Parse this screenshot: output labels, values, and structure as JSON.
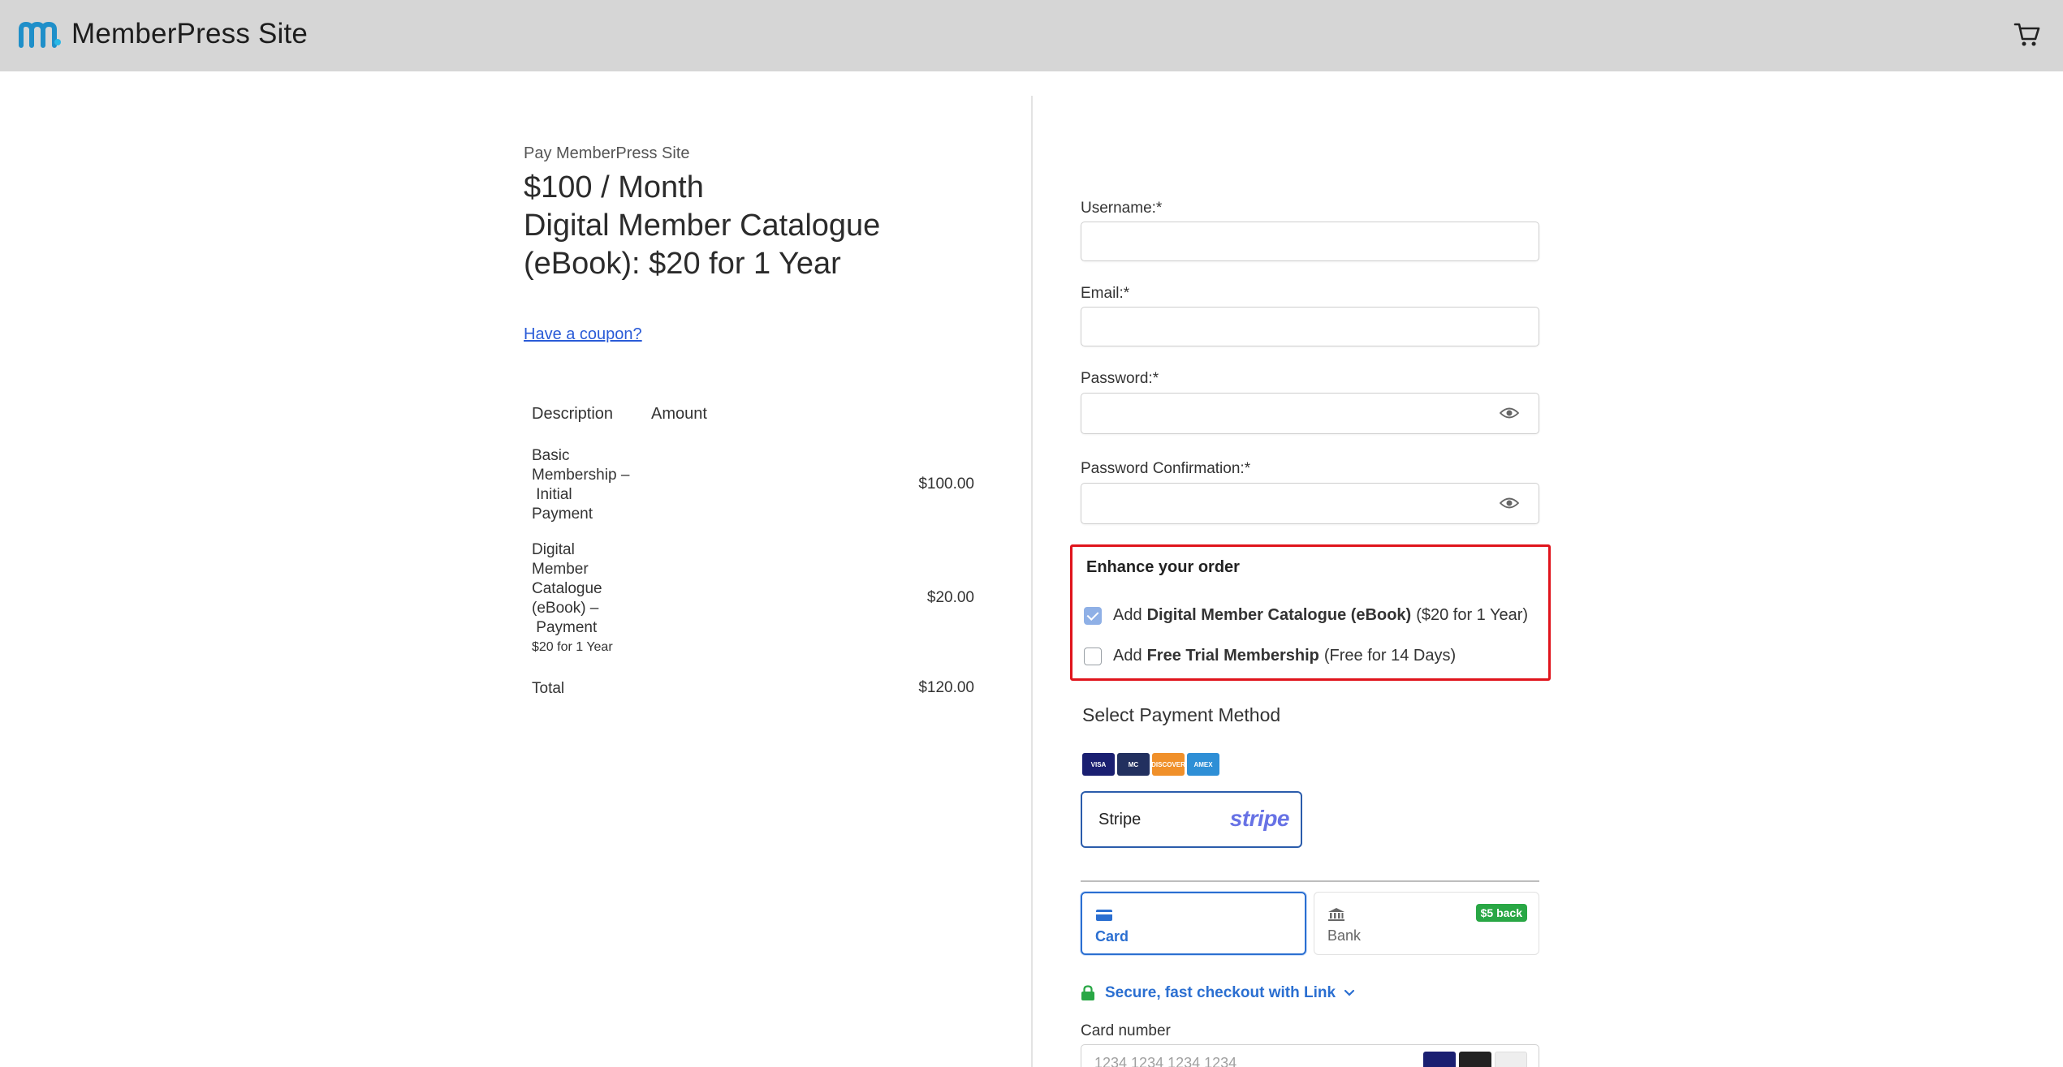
{
  "header": {
    "site_title": "MemberPress Site",
    "logo_icon": "memberpress-m-icon",
    "cart_icon": "cart-icon"
  },
  "summary": {
    "pay_label": "Pay MemberPress Site",
    "price": "$100 / Month",
    "product": "Digital Member Catalogue (eBook): $20 for 1 Year",
    "coupon_link": "Have a coupon?",
    "table": {
      "headers": [
        "Description",
        "Amount"
      ],
      "rows": [
        {
          "description_lines": [
            "Basic",
            "Membership –",
            " Initial",
            "Payment"
          ],
          "amount": "$100.00"
        },
        {
          "description_lines": [
            "Digital",
            "Member",
            "Catalogue",
            "(eBook) –",
            " Payment"
          ],
          "note": "$20 for 1 Year",
          "amount": "$20.00"
        }
      ],
      "total_label": "Total",
      "total_amount": "$120.00"
    }
  },
  "form": {
    "username_label": "Username:*",
    "email_label": "Email:*",
    "password_label": "Password:*",
    "password_confirm_label": "Password Confirmation:*",
    "enhance": {
      "title": "Enhance your order",
      "options": [
        {
          "prefix": "Add",
          "name": "Digital Member Catalogue (eBook)",
          "detail": "($20 for 1 Year)",
          "checked": true
        },
        {
          "prefix": "Add",
          "name": "Free Trial Membership",
          "detail": "(Free for 14 Days)",
          "checked": false
        }
      ]
    },
    "payment": {
      "title": "Select Payment Method",
      "card_brands": [
        "VISA",
        "MC",
        "DISCOVER",
        "AMEX"
      ],
      "gateway_label": "Stripe",
      "gateway_logo": "stripe",
      "tabs": [
        {
          "label": "Card",
          "icon": "credit-card-icon",
          "selected": true
        },
        {
          "label": "Bank",
          "icon": "bank-icon",
          "selected": false,
          "badge": "$5 back"
        }
      ],
      "link_text": "Secure, fast checkout with Link",
      "card_number_label": "Card number",
      "card_number_placeholder": "1234 1234 1234 1234"
    }
  },
  "colors": {
    "header_bg": "#d6d6d6",
    "accent_blue": "#2b6fd1",
    "highlight_red": "#e0141c",
    "stripe_purple": "#6772e5",
    "badge_green": "#29a745"
  }
}
